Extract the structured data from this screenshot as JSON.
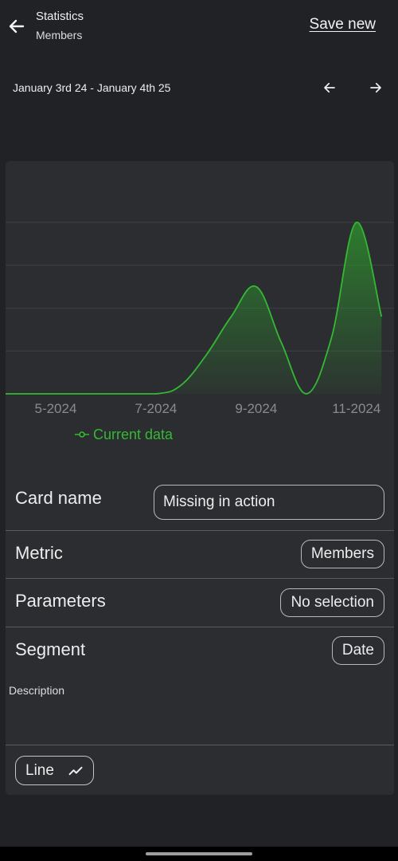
{
  "header": {
    "title": "Statistics",
    "subtitle": "Members",
    "back_icon": "arrow-left-icon",
    "save_label": "Save new"
  },
  "date_nav": {
    "range": "January 3rd 24  - January 4th 25",
    "prev_icon": "arrow-left-icon",
    "next_icon": "arrow-right-icon"
  },
  "chart_data": {
    "type": "area",
    "x_tick_labels": [
      "5-2024",
      "7-2024",
      "9-2024",
      "11-2024"
    ],
    "x": [
      "4-2024",
      "5-2024",
      "6-2024",
      "7-2024",
      "7.5-2024",
      "8-2024",
      "8.5-2024",
      "9-2024",
      "9.5-2024",
      "10-2024",
      "10.5-2024",
      "11-2024",
      "11.5-2024"
    ],
    "series": [
      {
        "name": "Current data",
        "values": [
          0,
          0,
          0,
          0,
          0.4,
          1.8,
          3.6,
          5.0,
          2.4,
          0,
          2.6,
          8.0,
          3.6
        ]
      }
    ],
    "ylim": [
      0,
      9
    ],
    "y_gridlines": [
      2,
      4,
      6,
      8
    ],
    "legend_position": "bottom-left",
    "grid": true,
    "series_color": "#33b933"
  },
  "legend": {
    "label": "Current data",
    "icon": "line-marker-icon"
  },
  "form": {
    "card_name_label": "Card name",
    "card_name_value": "Missing in action",
    "metric_label": "Metric",
    "metric_value": "Members",
    "parameters_label": "Parameters",
    "parameters_value": "No selection",
    "segment_label": "Segment",
    "segment_value": "Date",
    "description_label": "Description",
    "description_value": ""
  },
  "chart_type_button": {
    "label": "Line",
    "icon": "line-chart-icon"
  }
}
